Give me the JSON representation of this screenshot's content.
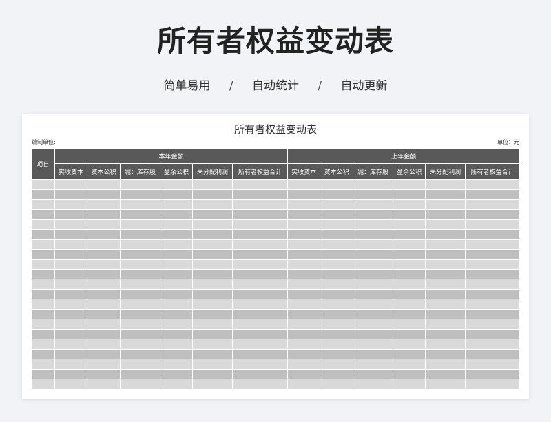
{
  "hero": {
    "title": "所有者权益变动表",
    "features": [
      "简单易用",
      "自动统计",
      "自动更新"
    ],
    "separator": "/"
  },
  "sheet": {
    "title": "所有者权益变动表",
    "prepared_by_label": "编制单位:",
    "unit_label": "单位：元",
    "item_header": "项目",
    "groups": [
      "本年金额",
      "上年金额"
    ],
    "columns": [
      "实收资本",
      "资本公积",
      "减：库存股",
      "盈余公积",
      "未分配利润",
      "所有者权益合计"
    ],
    "row_count": 21
  },
  "colors": {
    "header_bg": "#595959",
    "row_light": "#d9d9d9",
    "row_dark": "#bfbfbf",
    "page_bg": "#f2f3f7"
  }
}
